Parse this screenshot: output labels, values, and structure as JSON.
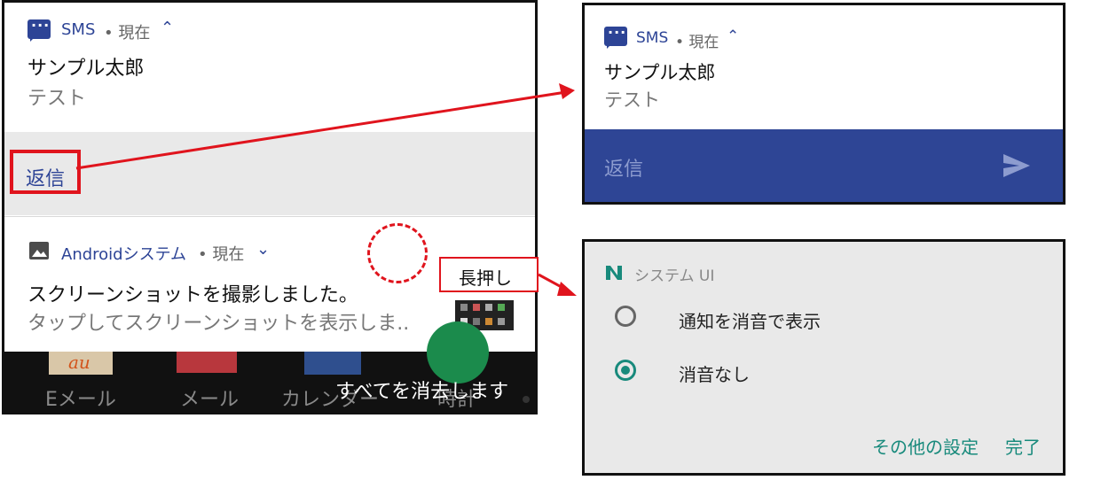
{
  "left_panel": {
    "notification1": {
      "app_name": "SMS",
      "meta": "• 現在",
      "expand_glyph": "⌃",
      "title": "サンプル太郎",
      "body": "テスト",
      "reply_label": "返信"
    },
    "notification2": {
      "app_name": "Androidシステム",
      "meta": "• 現在",
      "collapse_glyph": "⌄",
      "title": "スクリーンショットを撮影しました。",
      "body": "タップしてスクリーンショットを表示しま.."
    },
    "home_apps": [
      {
        "label": "Eメール",
        "icon_text": "au"
      },
      {
        "label": "メール"
      },
      {
        "label": "カレンダー"
      },
      {
        "label": "時計"
      }
    ],
    "clear_all_text": "すべてを消去します"
  },
  "annotations": {
    "long_press_label": "長押し",
    "colors": {
      "accent": "#e0141d"
    }
  },
  "right_top_panel": {
    "app_name": "SMS",
    "meta": "• 現在",
    "expand_glyph": "⌃",
    "title": "サンプル太郎",
    "body": "テスト",
    "reply_placeholder": "返信",
    "send_icon": "send-icon"
  },
  "right_bottom_panel": {
    "app_label": "システム UI",
    "options": [
      {
        "label": "通知を消音で表示",
        "selected": false
      },
      {
        "label": "消音なし",
        "selected": true
      }
    ],
    "more_settings": "その他の設定",
    "done": "完了",
    "colors": {
      "accent": "#188a7c"
    }
  }
}
